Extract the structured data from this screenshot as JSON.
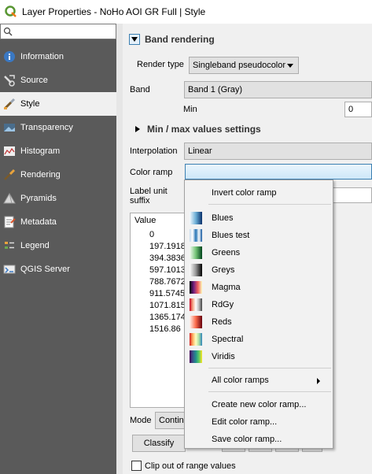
{
  "window": {
    "title": "Layer Properties - NoHo AOI GR Full | Style"
  },
  "sidebar": {
    "search_placeholder": "",
    "items": [
      {
        "label": "Information",
        "icon": "information-icon"
      },
      {
        "label": "Source",
        "icon": "source-icon"
      },
      {
        "label": "Style",
        "icon": "style-brush-icon",
        "active": true
      },
      {
        "label": "Transparency",
        "icon": "transparency-icon"
      },
      {
        "label": "Histogram",
        "icon": "histogram-icon"
      },
      {
        "label": "Rendering",
        "icon": "rendering-icon"
      },
      {
        "label": "Pyramids",
        "icon": "pyramids-icon"
      },
      {
        "label": "Metadata",
        "icon": "metadata-icon"
      },
      {
        "label": "Legend",
        "icon": "legend-icon"
      },
      {
        "label": "QGIS Server",
        "icon": "qgis-server-icon"
      }
    ]
  },
  "band_rendering": {
    "section_label": "Band rendering",
    "render_type_label": "Render type",
    "render_type_value": "Singleband pseudocolor",
    "band_label": "Band",
    "band_value": "Band 1 (Gray)",
    "min_label": "Min",
    "min_value": "0",
    "minmax_section_label": "Min / max values settings",
    "interpolation_label": "Interpolation",
    "interpolation_value": "Linear",
    "color_ramp_label": "Color ramp",
    "label_unit_label": "Label unit",
    "label_unit_label2": "suffix",
    "values_header": "Value",
    "values": [
      "0",
      "197.1918",
      "394.3836",
      "597.1013",
      "788.7672",
      "911.5745",
      "1071.815",
      "1365.174",
      "1516.86"
    ],
    "mode_label": "Mode",
    "mode_value": "Continu",
    "classify_label": "Classify",
    "clip_label": "Clip out of range values"
  },
  "color_ramp_menu": {
    "invert_label": "Invert color ramp",
    "ramps": [
      {
        "name": "Blues",
        "colors": [
          "#f7fbff",
          "#6baed6",
          "#08306b"
        ]
      },
      {
        "name": "Blues test",
        "colors": [
          "#c6dbef",
          "#ffffff",
          "#2171b5",
          "#ffffff",
          "#08519c"
        ]
      },
      {
        "name": "Greens",
        "colors": [
          "#f7fcf5",
          "#74c476",
          "#00441b"
        ]
      },
      {
        "name": "Greys",
        "colors": [
          "#ffffff",
          "#969696",
          "#000000"
        ]
      },
      {
        "name": "Magma",
        "colors": [
          "#000004",
          "#721f81",
          "#f1605d",
          "#fcfdbf"
        ]
      },
      {
        "name": "RdGy",
        "colors": [
          "#ca0020",
          "#f4a582",
          "#ffffff",
          "#bababa",
          "#404040"
        ]
      },
      {
        "name": "Reds",
        "colors": [
          "#fff5f0",
          "#fb6a4a",
          "#67000d"
        ]
      },
      {
        "name": "Spectral",
        "colors": [
          "#d7191c",
          "#fdae61",
          "#ffffbf",
          "#abdda4",
          "#2b83ba"
        ]
      },
      {
        "name": "Viridis",
        "colors": [
          "#440154",
          "#3b528b",
          "#21918c",
          "#5ec962",
          "#fde725"
        ]
      }
    ],
    "all_ramps_label": "All color ramps",
    "create_label": "Create new color ramp...",
    "edit_label": "Edit color ramp...",
    "save_label": "Save color ramp..."
  }
}
